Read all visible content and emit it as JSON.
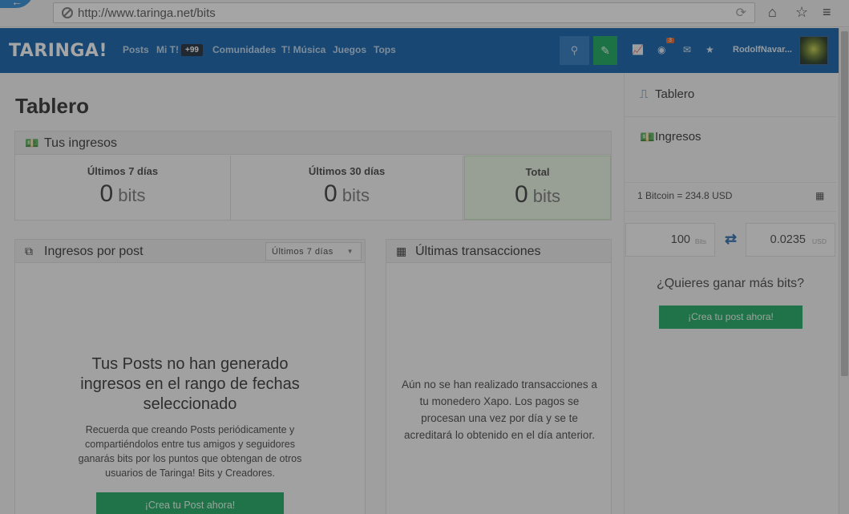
{
  "browser": {
    "url": "http://www.taringa.net/bits"
  },
  "header": {
    "logo": "TARINGA!",
    "nav": [
      "Posts",
      "Mi T!",
      "Comunidades",
      "T! Música",
      "Juegos",
      "Tops"
    ],
    "mit_badge": "+99",
    "notifications_count": "3",
    "username": "RodolfNavar..."
  },
  "main": {
    "title": "Tablero",
    "earnings": {
      "title": "Tus ingresos",
      "cols": [
        {
          "label": "Últimos 7 días",
          "value": "0",
          "unit": "bits"
        },
        {
          "label": "Últimos 30 días",
          "value": "0",
          "unit": "bits"
        },
        {
          "label": "Total",
          "value": "0",
          "unit": "bits"
        }
      ]
    },
    "per_post": {
      "title": "Ingresos por post",
      "range": "Últimos 7 días",
      "empty_title": "Tus Posts no han generado ingresos en el rango de fechas seleccionado",
      "empty_text": "Recuerda que creando Posts periódicamente y compartiéndolos entre tus amigos y seguidores ganarás bits por los puntos que obtengan de otros usuarios de Taringa! Bits y Creadores.",
      "button": "¡Crea tu Post ahora!"
    },
    "transactions": {
      "title": "Últimas transacciones",
      "empty_text": "Aún no se han realizado transacciones a tu monedero Xapo. Los pagos se procesan una vez por día y se te acreditará lo obtenido en el día anterior."
    }
  },
  "sidebar": {
    "items": [
      "Tablero",
      "Ingresos"
    ],
    "rate": "1 Bitcoin = 234.8 USD",
    "converter": {
      "bits_value": "100",
      "bits_unit": "Bits",
      "usd_value": "0.0235",
      "usd_unit": "USD"
    },
    "cta_question": "¿Quieres ganar más bits?",
    "cta_button": "¡Crea tu post ahora!"
  },
  "colors": {
    "header": "#0b5ea7",
    "green": "#1aa860",
    "accent_blue": "#2b6cb0"
  }
}
